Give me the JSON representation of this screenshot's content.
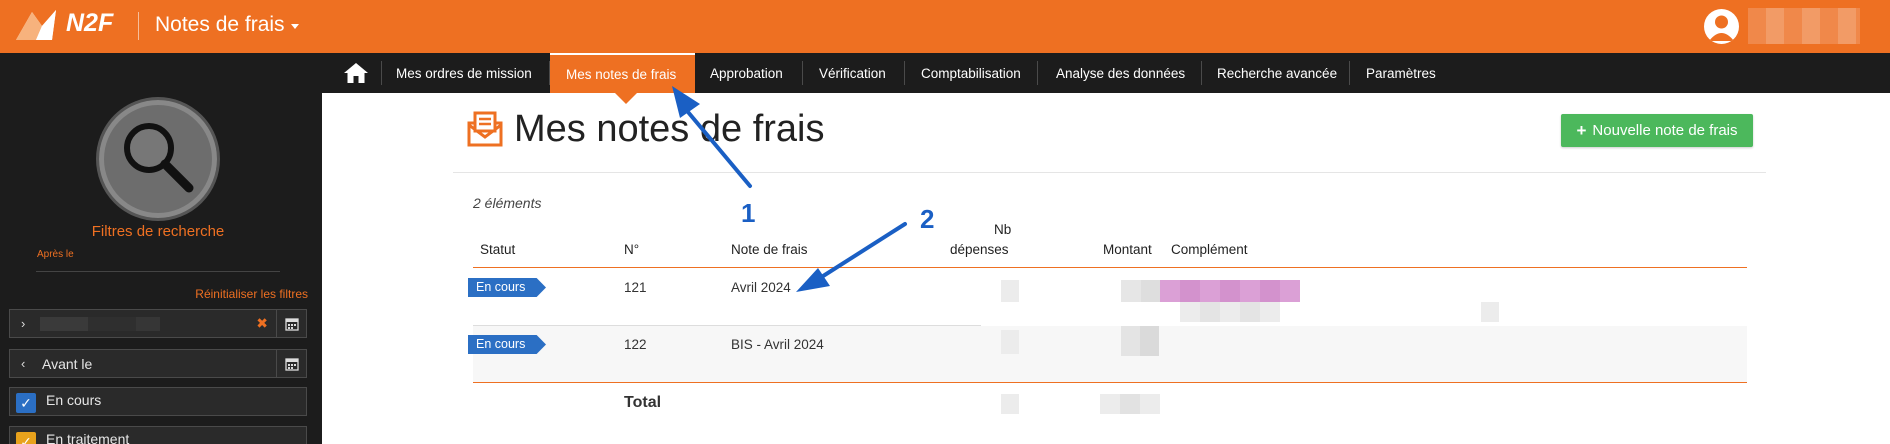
{
  "header": {
    "logo_text": "N2F",
    "app_title": "Notes de frais"
  },
  "nav": {
    "items": [
      {
        "label": "Mes ordres de mission"
      },
      {
        "label": "Mes notes de frais",
        "active": true
      },
      {
        "label": "Approbation"
      },
      {
        "label": "Vérification"
      },
      {
        "label": "Comptabilisation"
      },
      {
        "label": "Analyse des données"
      },
      {
        "label": "Recherche avancée"
      },
      {
        "label": "Paramètres"
      }
    ]
  },
  "sidebar": {
    "filter_title": "Filtres de recherche",
    "reset_label": "Réinitialiser les filtres",
    "after_label": "Après le",
    "before_label": "Avant le",
    "checks": [
      {
        "label": "En cours",
        "color": "#2b6fc4"
      },
      {
        "label": "En traitement",
        "color": "#e8a21c"
      }
    ]
  },
  "main": {
    "title": "Mes notes de frais",
    "new_button": "Nouvelle note de frais",
    "count_label": "2 éléments",
    "columns": {
      "statut": "Statut",
      "numero": "N°",
      "note": "Note de frais",
      "nb_line1": "Nb",
      "nb_line2": "dépenses",
      "montant": "Montant",
      "complement": "Complément"
    },
    "rows": [
      {
        "statut": "En cours",
        "numero": "121",
        "note": "Avril 2024"
      },
      {
        "statut": "En cours",
        "numero": "122",
        "note": "BIS - Avril 2024"
      }
    ],
    "total_label": "Total"
  },
  "annotations": [
    "1",
    "2"
  ],
  "colors": {
    "brand": "#ee7022",
    "nav_bg": "#1c1c1c",
    "badge": "#2b6fc4",
    "success": "#4cb85c",
    "annotation": "#1a5fc4"
  }
}
